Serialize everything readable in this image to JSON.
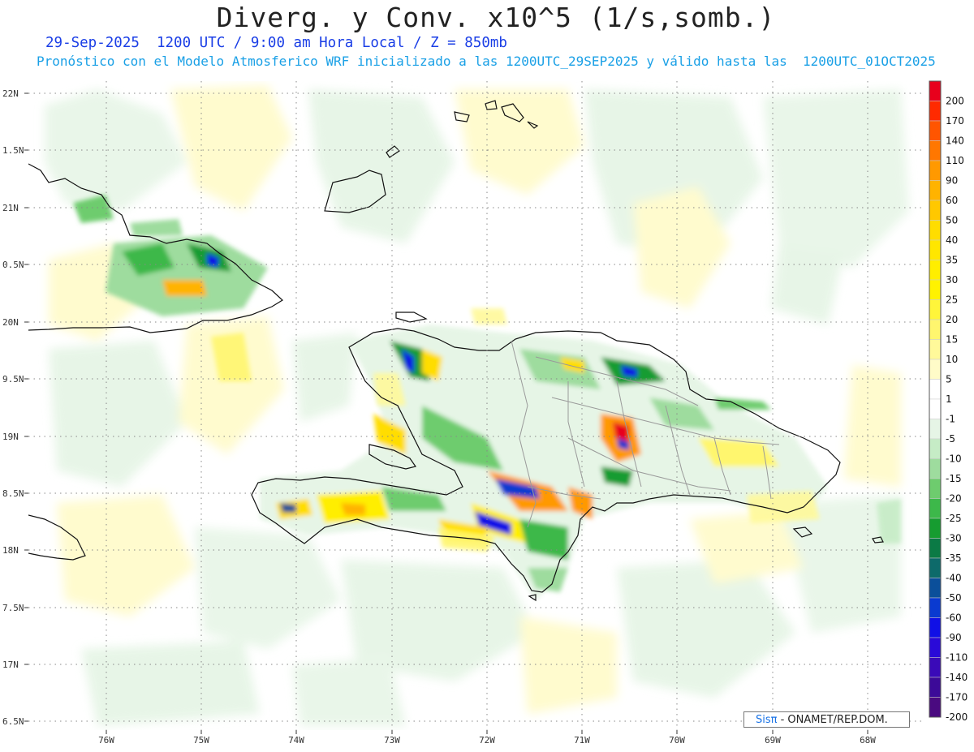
{
  "header": {
    "title": "Diverg. y Conv. x10^5 (1/s,somb.)",
    "valid_line": "29-Sep-2025  1200 UTC / 9:00 am Hora Local / Z = 850mb",
    "model_line": "Pronóstico con el Modelo Atmosferico WRF inicializado a las 1200UTC_29SEP2025 y válido hasta las  1200UTC_01OCT2025"
  },
  "axes": {
    "lat_labels": [
      "22N",
      "1.5N",
      "21N",
      "0.5N",
      "20N",
      "9.5N",
      "19N",
      "8.5N",
      "18N",
      "7.5N",
      "17N",
      "6.5N"
    ],
    "lon_labels": [
      "76W",
      "75W",
      "74W",
      "73W",
      "72W",
      "71W",
      "70W",
      "69W",
      "68W"
    ]
  },
  "colorbar": {
    "labels": [
      "200",
      "170",
      "140",
      "110",
      "90",
      "60",
      "50",
      "40",
      "35",
      "30",
      "25",
      "20",
      "15",
      "10",
      "5",
      "1",
      "-1",
      "-5",
      "-10",
      "-15",
      "-20",
      "-25",
      "-30",
      "-35",
      "-40",
      "-50",
      "-60",
      "-90",
      "-110",
      "-140",
      "-170",
      "-200"
    ],
    "colors": [
      "#e8001c",
      "#ff2a00",
      "#ff5500",
      "#ff7700",
      "#ff9900",
      "#ffb300",
      "#ffc800",
      "#ffdd00",
      "#ffe600",
      "#ffee00",
      "#fff200",
      "#fff53a",
      "#fff66e",
      "#fff99a",
      "#fffbc8",
      "#ffffff",
      "#ffffff",
      "#e6f5e6",
      "#c6ecc6",
      "#9edc9e",
      "#6ecc6e",
      "#3db84a",
      "#169c30",
      "#0b7a45",
      "#0d6a6a",
      "#0b4f9a",
      "#0a3ad0",
      "#1010e6",
      "#2a0ad8",
      "#3a0ab8",
      "#3c0a98",
      "#4a0a80"
    ]
  },
  "credit": {
    "brand": "Sisπ",
    "org": " - ONAMET/REP.DOM."
  }
}
